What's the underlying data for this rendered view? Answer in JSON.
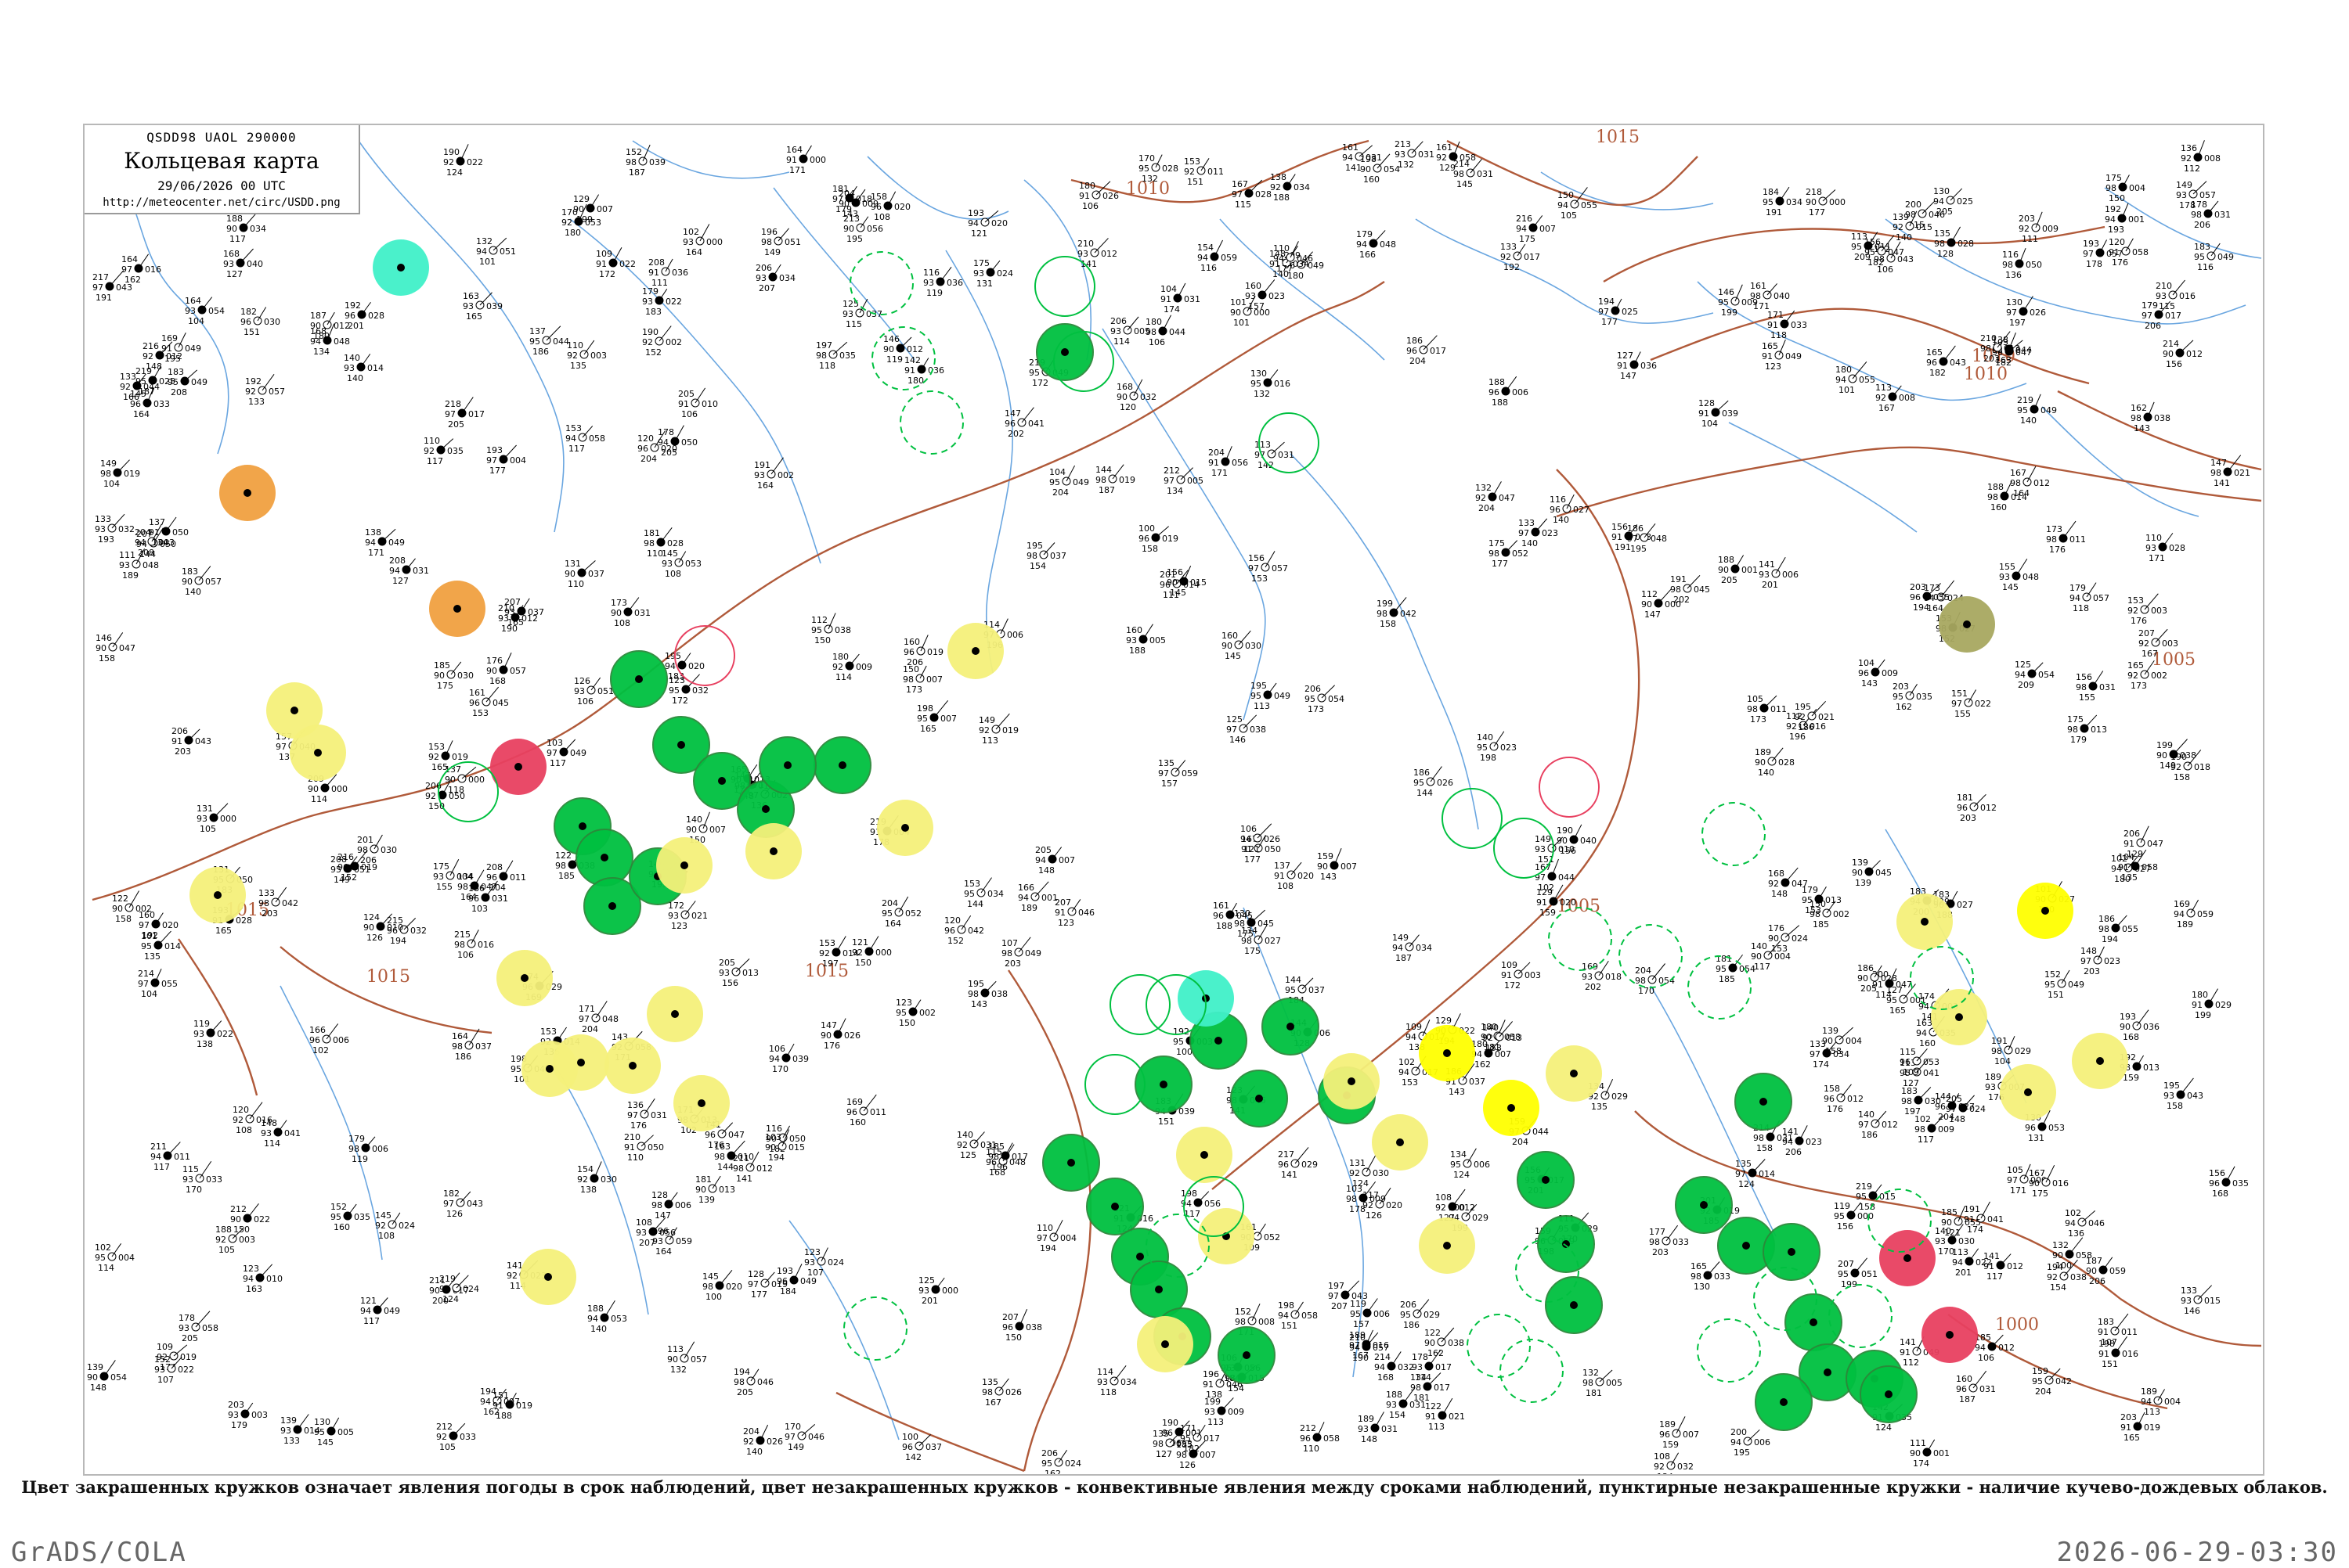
{
  "header": {
    "code": "QSDD98  UAOL  290000",
    "title": "Кольцевая карта",
    "date": "29/06/2026 00 UTC",
    "url": "http://meteocenter.net/circ/USDD.png"
  },
  "caption": "Цвет закрашенных кружков означает явления погоды в срок наблюдений, цвет незакрашенных кружков - конвективные явления между сроками наблюдений, пунктирные незакрашенные кружки - наличие кучево-дождевых облаков.",
  "footer": {
    "left": "GrADS/COLA",
    "right": "2026-06-29-03:30"
  },
  "colors": {
    "frame": "#b8b8b8",
    "isobar": "#b05a3a",
    "river": "#6aa6e0",
    "phenomena_green": "#00c040",
    "phenomena_yellow": "#f4f07a",
    "phenomena_bright_yellow": "#ffff00",
    "phenomena_orange": "#f0a040",
    "phenomena_red": "#e84060",
    "phenomena_cyan": "#40f0c8",
    "phenomena_olive": "#a8a860"
  },
  "isobar_labels": [
    "1015",
    "1010",
    "1015",
    "1010",
    "1005",
    "1005",
    "1015",
    "1015",
    "1010",
    "1000"
  ],
  "station_circles": [
    {
      "type": "filled",
      "color": "green"
    },
    {
      "type": "filled",
      "color": "yellow"
    },
    {
      "type": "filled",
      "color": "bright_yellow"
    },
    {
      "type": "filled",
      "color": "orange"
    },
    {
      "type": "filled",
      "color": "red"
    },
    {
      "type": "filled",
      "color": "cyan"
    },
    {
      "type": "filled",
      "color": "olive"
    },
    {
      "type": "open",
      "color": "green"
    },
    {
      "type": "open",
      "color": "red"
    },
    {
      "type": "dashed",
      "color": "green"
    }
  ]
}
